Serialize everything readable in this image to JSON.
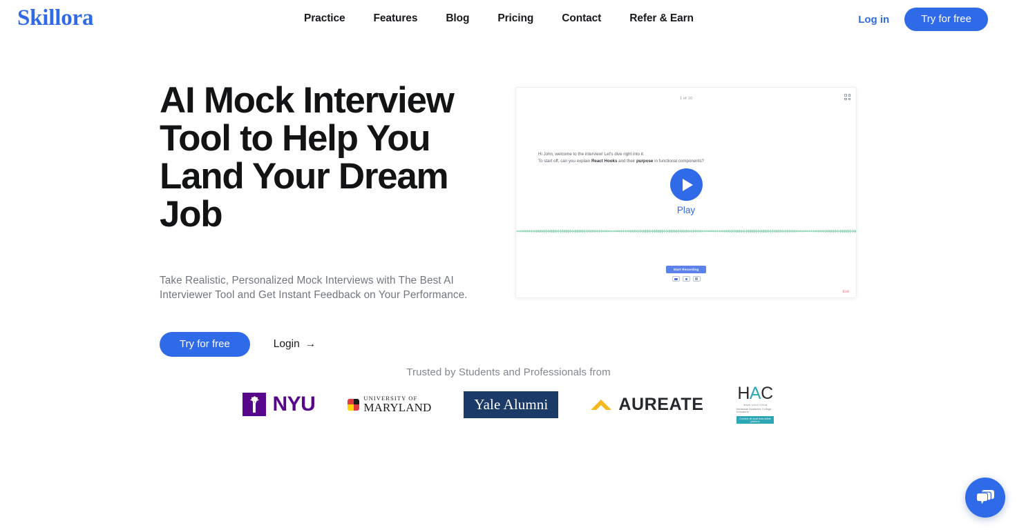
{
  "header": {
    "logo": "Skillora",
    "nav": [
      {
        "label": "Practice"
      },
      {
        "label": "Features"
      },
      {
        "label": "Blog"
      },
      {
        "label": "Pricing"
      },
      {
        "label": "Contact"
      },
      {
        "label": "Refer & Earn"
      }
    ],
    "login_label": "Log in",
    "cta_label": "Try for free"
  },
  "hero": {
    "title": "AI Mock Interview Tool to Help You Land Your Dream Job",
    "subtitle": "Take Realistic, Personalized Mock Interviews with The Best AI Interviewer Tool and Get Instant Feedback on Your Performance.",
    "primary_cta": "Try for free",
    "secondary_cta": "Login",
    "secondary_cta_arrow": "→"
  },
  "demo": {
    "counter": "1 of 10",
    "line1": "Hi John, welcome to the interview! Let's dive right into it.",
    "line2_prefix": "To start off, can you explain ",
    "line2_bold1": "React Hooks",
    "line2_middle": " and their ",
    "line2_bold2": "purpose",
    "line2_suffix": " in functional components?",
    "play_label": "Play",
    "record_label": "Start Recording",
    "exit_label": "Exit"
  },
  "trusted": {
    "heading": "Trusted by Students and Professionals from",
    "logos": [
      {
        "name": "NYU",
        "text": "NYU",
        "color": "#57068c"
      },
      {
        "name": "University of Maryland",
        "line1": "UNIVERSITY OF",
        "line2": "MARYLAND",
        "color": "#1b1b1b"
      },
      {
        "name": "Yale Alumni",
        "text": "Yale Alumni",
        "color": "#1b3a68"
      },
      {
        "name": "Aureate",
        "text": "AUREATE",
        "color": "#f5b820"
      },
      {
        "name": "HAC",
        "text_h": "H",
        "text_a": "A",
        "text_c": "C",
        "sub1": "מכללה לחינוך אקדמי",
        "sub2": "Hadassah Academic College Jerusalem",
        "bar": "Connect all local area online platform",
        "color": "#2ba7b5"
      }
    ]
  },
  "chat": {
    "label": "chat-widget"
  },
  "colors": {
    "accent": "#2f6ae8",
    "text_dark": "#111315",
    "text_muted": "#717680",
    "waveform": "#5cbf92"
  }
}
